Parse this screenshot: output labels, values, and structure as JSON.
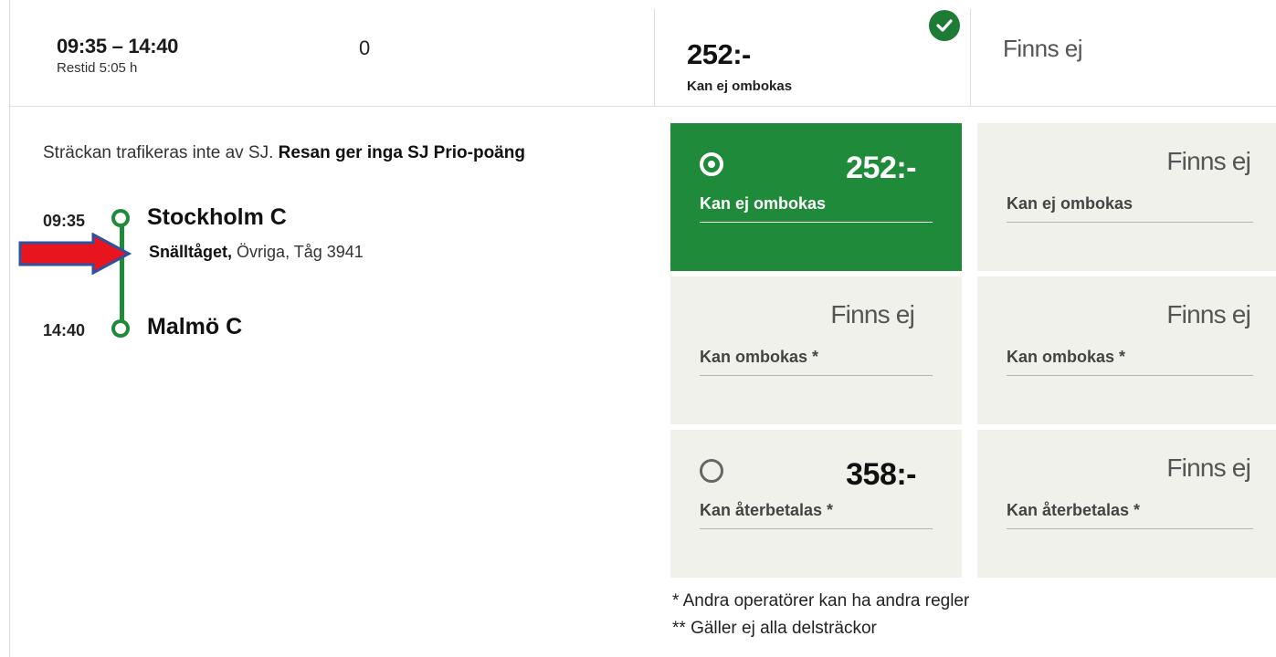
{
  "journey": {
    "times": "09:35 – 14:40",
    "duration": "Restid 5:05 h",
    "changes": "0"
  },
  "top_fares": {
    "col1_price": "252:-",
    "col1_condition": "Kan ej ombokas",
    "col2_value": "Finns ej",
    "selected_icon": "check-icon"
  },
  "details": {
    "info_text": "Sträckan trafikeras inte av SJ. ",
    "info_bold": "Resan ger inga SJ Prio-poäng",
    "departure_time": "09:35",
    "departure_station": "Stockholm C",
    "operator": "Snälltåget,",
    "train_info": "Övriga, Tåg 3941",
    "arrival_time": "14:40",
    "arrival_station": "Malmö C"
  },
  "fare_cards": [
    {
      "value": "252:-",
      "condition": "Kan ej ombokas",
      "selected": true
    },
    {
      "value": "Finns ej",
      "condition": "Kan ej ombokas"
    },
    {
      "value": "Finns ej",
      "condition": "Kan ombokas *"
    },
    {
      "value": "Finns ej",
      "condition": "Kan ombokas *"
    },
    {
      "value": "358:-",
      "condition": "Kan återbetalas *",
      "selected": false
    },
    {
      "value": "Finns ej",
      "condition": "Kan återbetalas *"
    }
  ],
  "footnotes": {
    "note1": "* Andra operatörer kan ha andra regler",
    "note2": "** Gäller ej alla delsträckor"
  },
  "colors": {
    "accent_green": "#1e8a3a",
    "card_bg": "#f1f1ec",
    "arrow_red": "#e8141e",
    "arrow_outline": "#2f52a0"
  }
}
